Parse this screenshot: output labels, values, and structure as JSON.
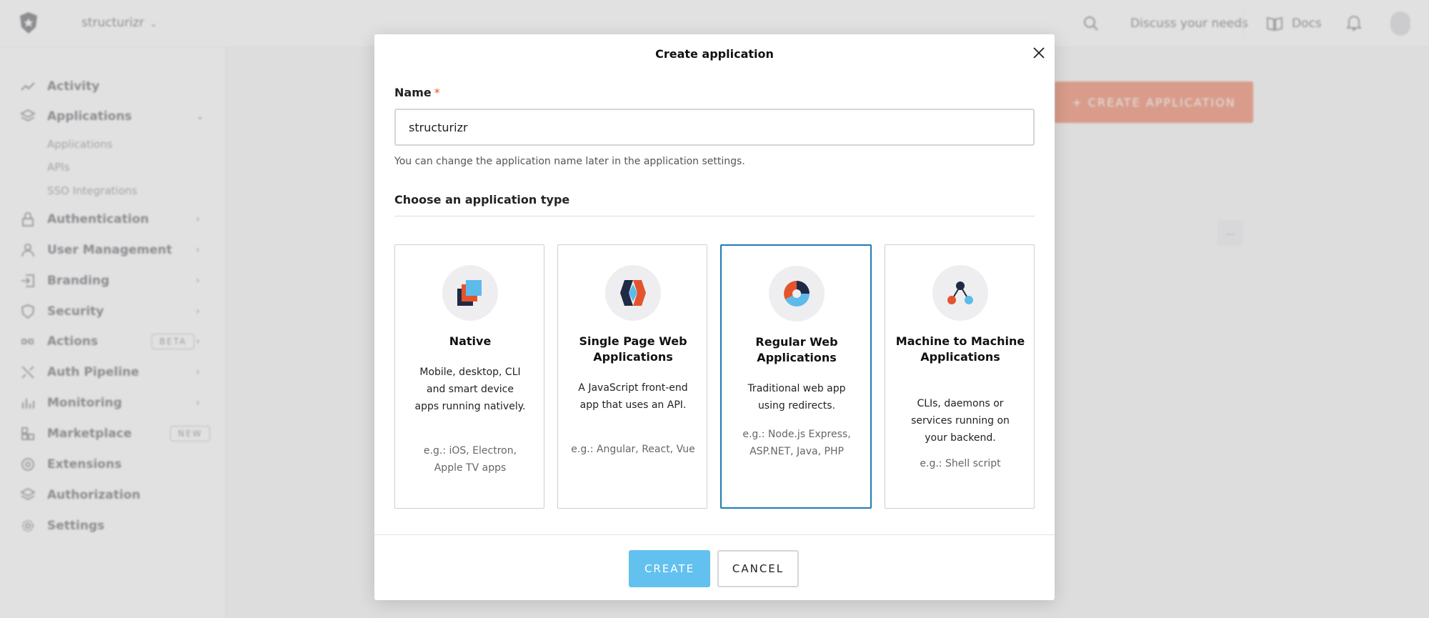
{
  "background": {
    "tenant": "structurizr",
    "top_links": {
      "discuss": "Discuss your needs",
      "docs": "Docs"
    },
    "sidebar": {
      "items": [
        {
          "label": "Activity",
          "icon": "activity-icon"
        },
        {
          "label": "Applications",
          "icon": "applications-icon"
        },
        {
          "label": "Authentication",
          "icon": "lock-icon"
        },
        {
          "label": "User Management",
          "icon": "user-icon"
        },
        {
          "label": "Branding",
          "icon": "branding-icon"
        },
        {
          "label": "Security",
          "icon": "shield-icon"
        },
        {
          "label": "Actions",
          "icon": "actions-icon",
          "badge": "BETA"
        },
        {
          "label": "Auth Pipeline",
          "icon": "pipeline-icon"
        },
        {
          "label": "Monitoring",
          "icon": "chart-icon"
        },
        {
          "label": "Marketplace",
          "icon": "marketplace-icon",
          "badge": "NEW"
        },
        {
          "label": "Extensions",
          "icon": "extensions-icon"
        },
        {
          "label": "Authorization",
          "icon": "authorization-icon"
        },
        {
          "label": "Settings",
          "icon": "gear-icon"
        }
      ],
      "subitems": [
        "Applications",
        "APIs",
        "SSO Integrations"
      ]
    },
    "create_application_label": "+ CREATE APPLICATION",
    "more_label": "..."
  },
  "modal": {
    "title": "Create application",
    "name_label": "Name",
    "required_mark": "*",
    "name_value": "structurizr",
    "name_help": "You can change the application name later in the application settings.",
    "type_heading": "Choose an application type",
    "cards": [
      {
        "title": "Native",
        "description": "Mobile, desktop, CLI and smart device apps running natively.",
        "example": "e.g.: iOS, Electron, Apple TV apps",
        "icon": "native-icon",
        "selected": false
      },
      {
        "title": "Single Page Web Applications",
        "description": "A JavaScript front-end app that uses an API.",
        "example": "e.g.: Angular, React, Vue",
        "icon": "spa-icon",
        "selected": false
      },
      {
        "title": "Regular Web Applications",
        "description": "Traditional web app using redirects.",
        "example": "e.g.: Node.js Express, ASP.NET, Java, PHP",
        "icon": "regular-web-icon",
        "selected": true
      },
      {
        "title": "Machine to Machine Applications",
        "description": "CLIs, daemons or services running on your backend.",
        "example": "e.g.: Shell script",
        "icon": "m2m-icon",
        "selected": false
      }
    ],
    "create_label": "CREATE",
    "cancel_label": "CANCEL"
  },
  "colors": {
    "accent_orange": "#eb5424",
    "selected_border": "#1d7cb4",
    "create_button": "#63c1ef",
    "icon_navy": "#1f2a44",
    "icon_blue": "#5dbbea",
    "icon_orange": "#e5532d"
  }
}
